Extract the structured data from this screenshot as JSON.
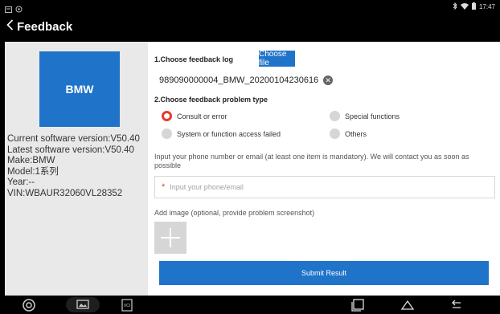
{
  "status_bar": {
    "time": "17:47",
    "icons": [
      "notification-icon",
      "settings-icon",
      "bluetooth-icon",
      "wifi-icon",
      "battery-icon"
    ]
  },
  "header": {
    "back_icon": "chevron-left-icon",
    "title": "Feedback"
  },
  "vehicle": {
    "logo_text": "BMW",
    "current_version": "Current software version:V50.40",
    "latest_version": "Latest software version:V50.40",
    "make": "Make:BMW",
    "model": "Model:1系列",
    "year": "Year:--",
    "vin": "VIN:WBAUR32060VL28352"
  },
  "feedback": {
    "log_label": "1.Choose feedback log",
    "choose_file_label": "Choose file",
    "log_file": "989090000004_BMW_20200104230616",
    "problem_type_label": "2.Choose feedback problem type",
    "options": [
      {
        "label": "Consult or error",
        "checked": true
      },
      {
        "label": "Special functions",
        "checked": false
      },
      {
        "label": "System or function access failed",
        "checked": false
      },
      {
        "label": "Others",
        "checked": false
      }
    ],
    "contact_hint": "Input your phone number or email (at least one item is mandatory). We will contact you as soon as possible",
    "contact_required_mark": "*",
    "contact_placeholder": "Input your phone/email",
    "add_image_label": "Add image (optional, provide problem screenshot)",
    "submit_label": "Submit Result"
  },
  "bottom_nav": {
    "items": [
      "diagnostics-home-icon",
      "screenshot-icon",
      "vci-icon",
      "recent-apps-icon",
      "home-icon",
      "back-icon"
    ],
    "vci_label": "VCI"
  },
  "colors": {
    "accent": "#1f73c8",
    "radio_checked": "#e8392e",
    "panel_bg": "#e9e9e9",
    "radio_off": "#d6d6d6"
  }
}
